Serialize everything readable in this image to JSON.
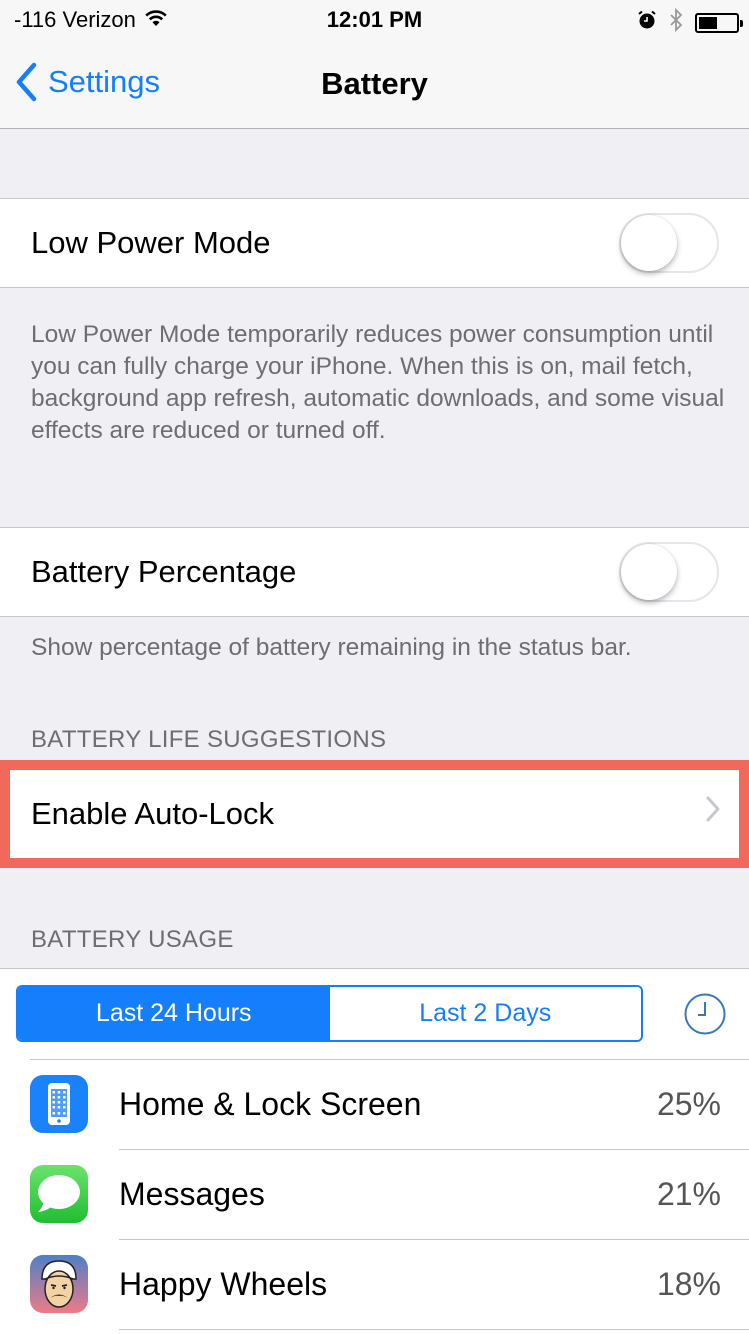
{
  "status_bar": {
    "carrier": "-116 Verizon",
    "time": "12:01 PM",
    "battery_level": 0.5,
    "icons": [
      "wifi-icon",
      "alarm-icon",
      "bluetooth-icon",
      "battery-icon"
    ]
  },
  "nav": {
    "back_label": "Settings",
    "title": "Battery"
  },
  "low_power": {
    "label": "Low Power Mode",
    "enabled": false,
    "description": "Low Power Mode temporarily reduces power consumption until you can fully charge your iPhone. When this is on, mail fetch, background app refresh, automatic downloads, and some visual effects are reduced or turned off."
  },
  "battery_percentage": {
    "label": "Battery Percentage",
    "enabled": false,
    "description": "Show percentage of battery remaining in the status bar."
  },
  "suggestions": {
    "header": "BATTERY LIFE SUGGESTIONS",
    "items": [
      {
        "label": "Enable Auto-Lock"
      }
    ]
  },
  "usage": {
    "header": "BATTERY USAGE",
    "segments": [
      {
        "label": "Last 24 Hours",
        "active": true
      },
      {
        "label": "Last 2 Days",
        "active": false
      }
    ],
    "apps": [
      {
        "name": "Home & Lock Screen",
        "percent": "25%",
        "icon": "home-lock-screen-icon"
      },
      {
        "name": "Messages",
        "percent": "21%",
        "icon": "messages-icon"
      },
      {
        "name": "Happy Wheels",
        "percent": "18%",
        "icon": "happy-wheels-icon"
      }
    ]
  },
  "colors": {
    "accent": "#157efb",
    "highlight": "#f0695a",
    "background": "#efeff4",
    "secondary_text": "#6d6d72"
  }
}
